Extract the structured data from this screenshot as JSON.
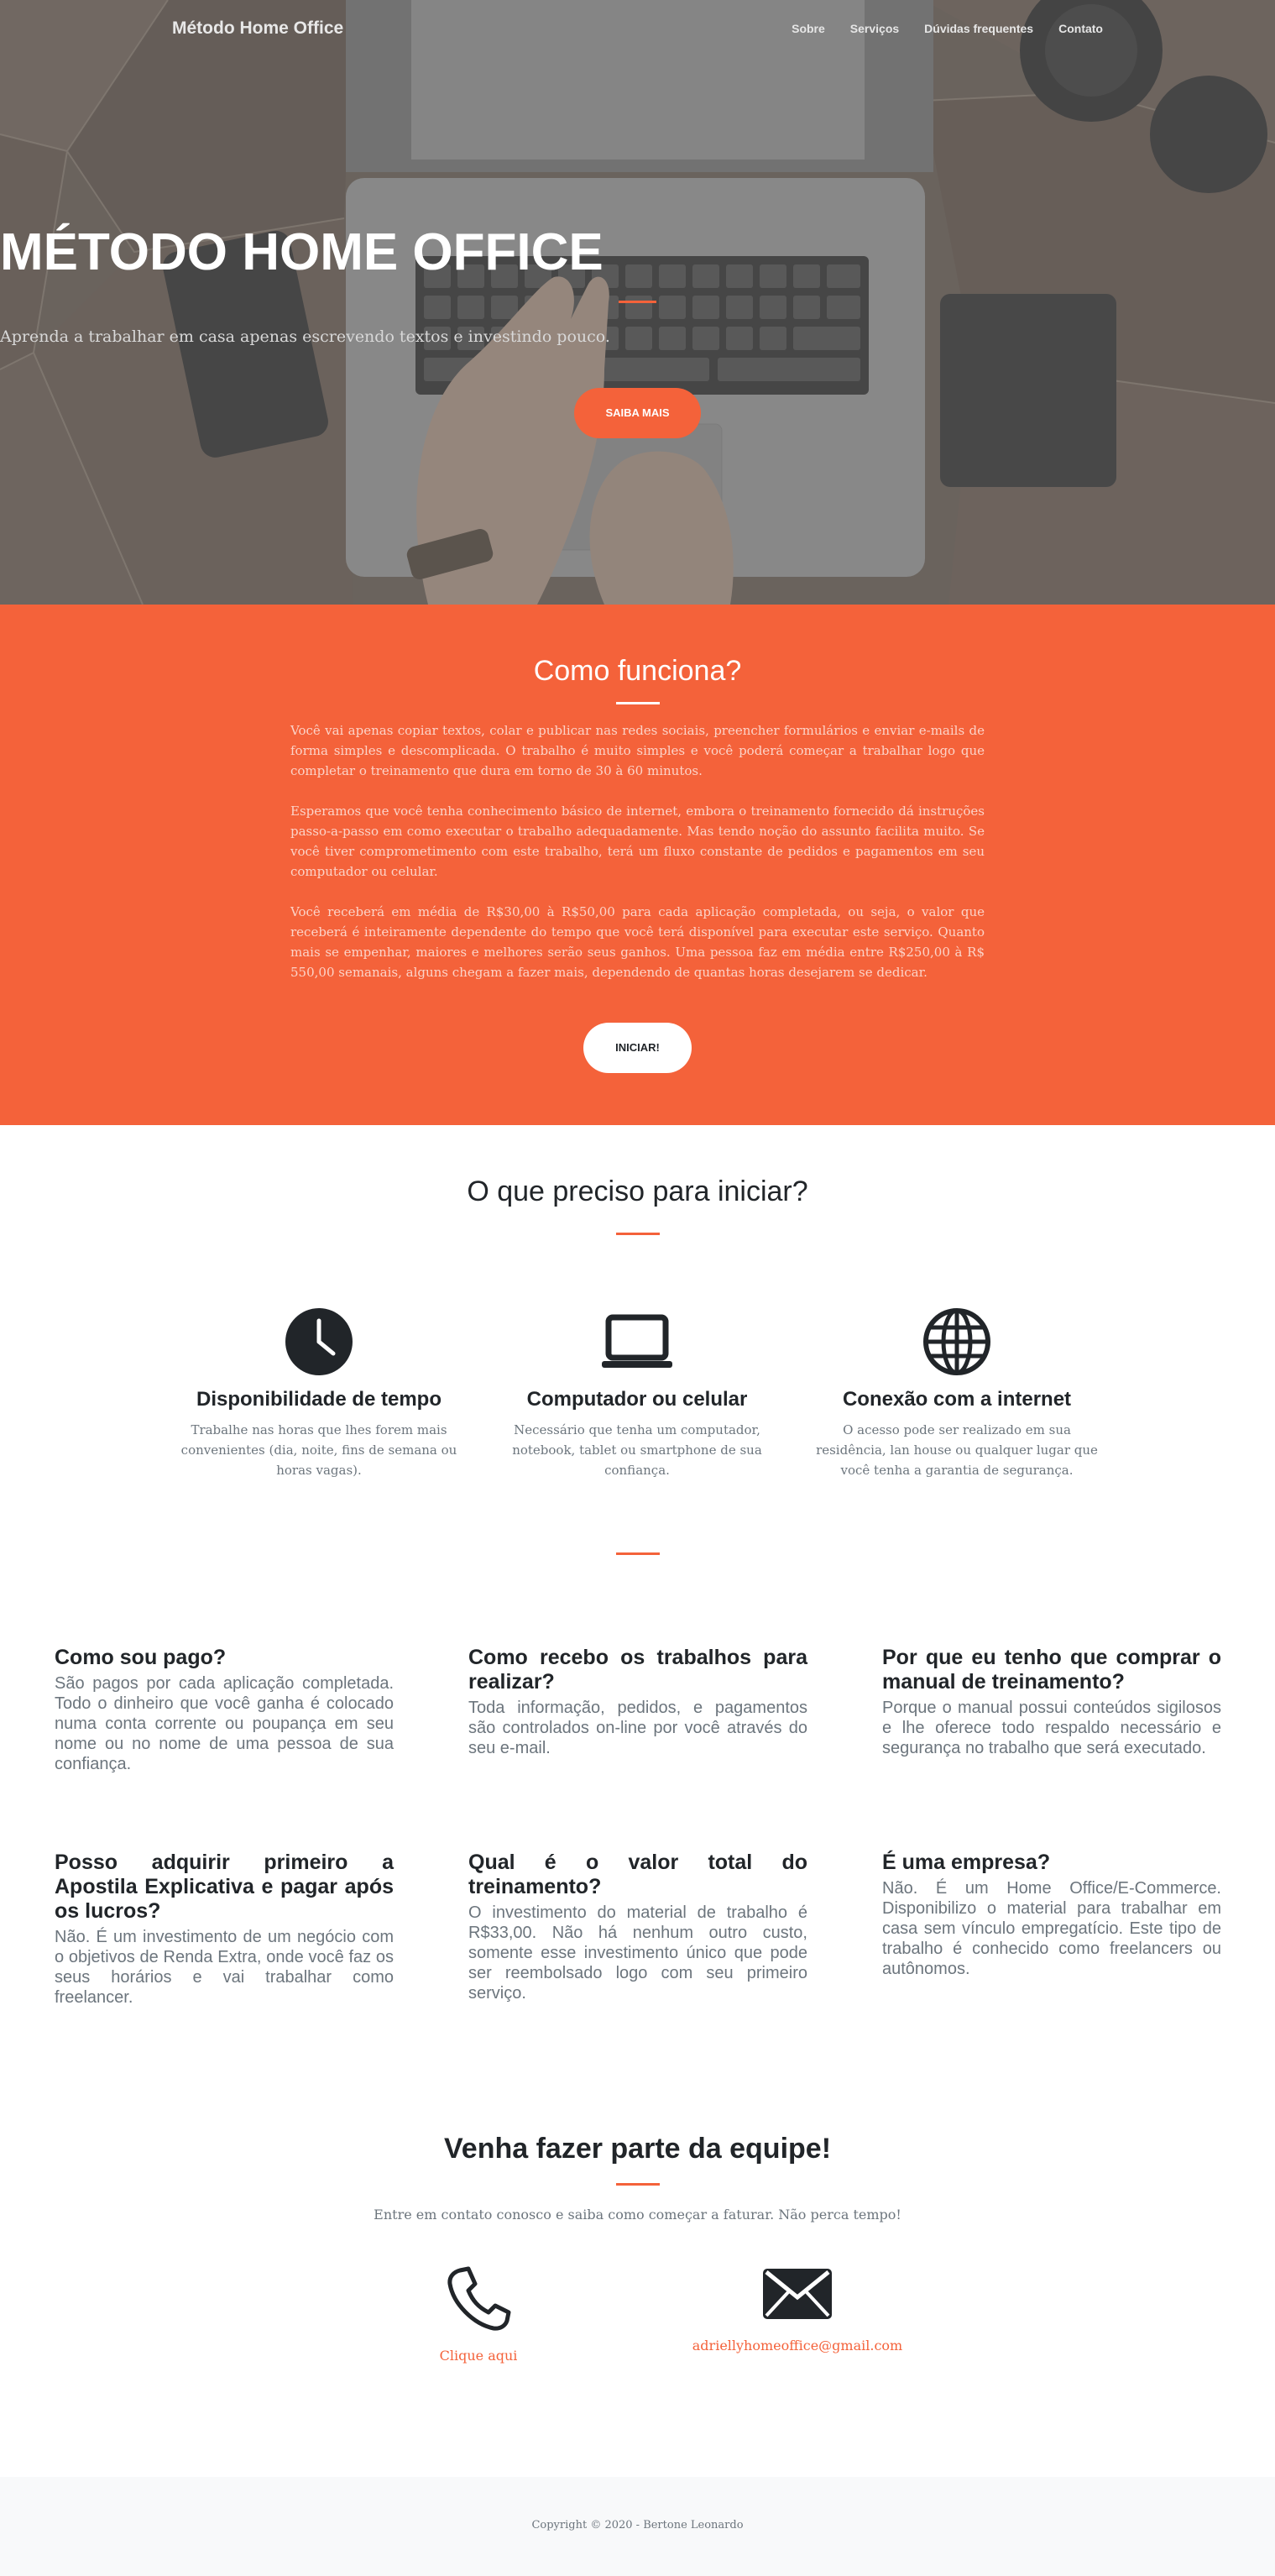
{
  "nav": {
    "brand": "Método Home Office",
    "links": [
      "Sobre",
      "Serviços",
      "Dúvidas frequentes",
      "Contato"
    ]
  },
  "hero": {
    "title": "MÉTODO HOME OFFICE",
    "subtitle": "Aprenda a trabalhar em casa apenas escrevendo textos e investindo pouco.",
    "button": "Saiba mais"
  },
  "how": {
    "title": "Como funciona?",
    "paragraphs": [
      "Você vai apenas copiar textos, colar e publicar nas redes sociais, preencher formulários e enviar e-mails de forma simples e descomplicada. O trabalho é muito simples e você poderá começar a trabalhar logo que completar o treinamento que dura em torno de 30 à 60 minutos.",
      "Esperamos que você tenha conhecimento básico de internet, embora o treinamento fornecido dá instruções passo-a-passo em como executar o trabalho adequadamente. Mas tendo noção do assunto facilita muito. Se você tiver comprometimento com este trabalho, terá um fluxo constante de pedidos e pagamentos em seu computador ou celular.",
      "Você receberá em média de R$30,00 à R$50,00 para cada aplicação completada, ou seja, o valor que receberá é inteiramente dependente do tempo que você terá disponível para executar este serviço. Quanto mais se empenhar, maiores e melhores serão seus ganhos. Uma pessoa faz em média entre R$250,00 à R$ 550,00 semanais, alguns chegam a fazer mais, dependendo de quantas horas desejarem se dedicar."
    ],
    "button": "Iniciar!"
  },
  "requirements": {
    "title": "O que preciso para iniciar?",
    "items": [
      {
        "icon": "clock-icon",
        "title": "Disponibilidade de tempo",
        "text": "Trabalhe nas horas que lhes forem mais convenientes (dia, noite, fins de semana ou horas vagas)."
      },
      {
        "icon": "laptop-icon",
        "title": "Computador ou celular",
        "text": "Necessário que tenha um computador, notebook, tablet ou smartphone de sua confiança."
      },
      {
        "icon": "globe-icon",
        "title": "Conexão com a internet",
        "text": "O acesso pode ser realizado em sua residência, lan house ou qualquer lugar que você tenha a garantia de segurança."
      }
    ]
  },
  "faq": [
    {
      "q": "Como sou pago?",
      "a": "São pagos por cada aplicação completada. Todo o dinheiro que você ganha é colocado numa conta corrente ou poupança em seu nome ou no nome de uma pessoa de sua confiança."
    },
    {
      "q": "Como recebo os trabalhos para realizar?",
      "a": "Toda informação, pedidos, e pagamentos são controlados on-line por você através do seu e-mail."
    },
    {
      "q": "Por que eu tenho que comprar o manual de treinamento?",
      "a": "Porque o manual possui conteúdos sigilosos e lhe oferece todo respaldo necessário e segurança no trabalho que será executado."
    },
    {
      "q": "Posso adquirir primeiro a Apostila Explicativa e pagar após os lucros?",
      "a": "Não. É um investimento de um negócio com o objetivos de Renda Extra, onde você faz os seus horários e vai trabalhar como freelancer."
    },
    {
      "q": "Qual é o valor total do treinamento?",
      "a": "O investimento do material de trabalho é R$33,00. Não há nenhum outro custo, somente esse investimento único que pode ser reembolsado logo com seu primeiro serviço."
    },
    {
      "q": "É uma empresa?",
      "a": "Não. É um Home Office/E-Commerce. Disponibilizo o material para trabalhar em casa sem vínculo empregatício. Este tipo de trabalho é conhecido como freelancers ou autônomos."
    }
  ],
  "contact": {
    "title": "Venha fazer parte da equipe!",
    "subtitle": "Entre em contato conosco e saiba como começar a faturar. Não perca tempo!",
    "phone_link": "Clique aqui",
    "email_link": "adriellyhomeoffice@gmail.com"
  },
  "footer": {
    "copyright": "Copyright © 2020 - Bertone Leonardo"
  },
  "colors": {
    "primary": "#f4623a",
    "dark": "#212529",
    "muted": "#6c757d"
  }
}
